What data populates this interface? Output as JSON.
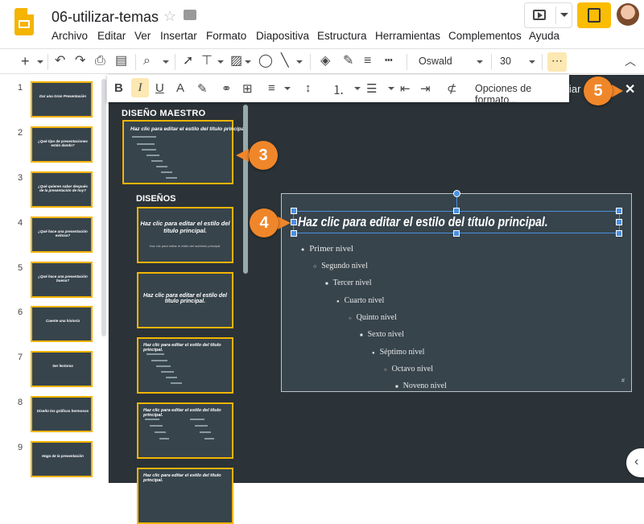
{
  "app": {
    "doc_title": "06-utilizar-temas",
    "menu": [
      "Archivo",
      "Editar",
      "Ver",
      "Insertar",
      "Formato",
      "Diapositiva",
      "Estructura",
      "Herramientas",
      "Complementos",
      "Ayuda"
    ]
  },
  "toolbar": {
    "font": "Oswald",
    "font_size": "30",
    "more": "⋯"
  },
  "format_bar": {
    "options_label": "Opciones de formato..."
  },
  "filmstrip": {
    "slides": [
      {
        "num": "1",
        "text": "Dar una Gran Presentación"
      },
      {
        "num": "2",
        "text": "¿Qué tipo de presentaciones están dando?"
      },
      {
        "num": "3",
        "text": "¿Qué quieren saber después de la presentación de hoy?"
      },
      {
        "num": "4",
        "text": "¿Qué hace una presentación exitosa?"
      },
      {
        "num": "5",
        "text": "¿Qué hace una presentación buena?"
      },
      {
        "num": "6",
        "text": "Cuente una historia"
      },
      {
        "num": "7",
        "text": "Ser lectoras"
      },
      {
        "num": "8",
        "text": "Diseño los gráficos hermosos"
      },
      {
        "num": "9",
        "text": "Haga de la presentación"
      }
    ]
  },
  "theme_panel": {
    "master_title": "DISEÑO MAESTRO",
    "layouts_title": "DISEÑOS",
    "header_partial": "iar",
    "close": "✕",
    "master_thumb_title": "Haz clic para editar el estilo del título principal.",
    "layouts": [
      {
        "title": "Haz clic para editar el estilo del título principal.",
        "sub": "Haz clic para editar el estilo del subtítulo principal."
      },
      {
        "title": "Haz clic para editar el estilo del título principal.",
        "sub": ""
      },
      {
        "title": "Haz clic para editar el estilo del título principal.",
        "sub": ""
      },
      {
        "title": "Haz clic para editar el estilo del título principal.",
        "sub": ""
      },
      {
        "title": "Haz clic para editar el estilo del título principal.",
        "sub": ""
      }
    ]
  },
  "slide": {
    "title": "Haz clic para editar el estilo del título principal.",
    "levels": [
      {
        "bullet": "●",
        "text": "Primer nivel"
      },
      {
        "bullet": "○",
        "text": "Segundo nivel"
      },
      {
        "bullet": "■",
        "text": "Tercer nivel"
      },
      {
        "bullet": "●",
        "text": "Cuarto nivel"
      },
      {
        "bullet": "○",
        "text": "Quinto nivel"
      },
      {
        "bullet": "■",
        "text": "Sexto nivel"
      },
      {
        "bullet": "●",
        "text": "Séptimo nivel"
      },
      {
        "bullet": "○",
        "text": "Octavo nivel"
      },
      {
        "bullet": "■",
        "text": "Noveno nivel"
      }
    ],
    "number_mark": "#"
  },
  "callouts": [
    "3",
    "4",
    "5"
  ],
  "colors": {
    "accent": "#f4b400",
    "callout": "#f0862a",
    "slide_bg": "#37444c",
    "panel_bg": "#2b3338",
    "selection": "#4a90e2"
  },
  "icons": [
    "slides-logo-icon",
    "star-icon",
    "folder-icon",
    "present-icon",
    "share-icon",
    "close-icon"
  ]
}
